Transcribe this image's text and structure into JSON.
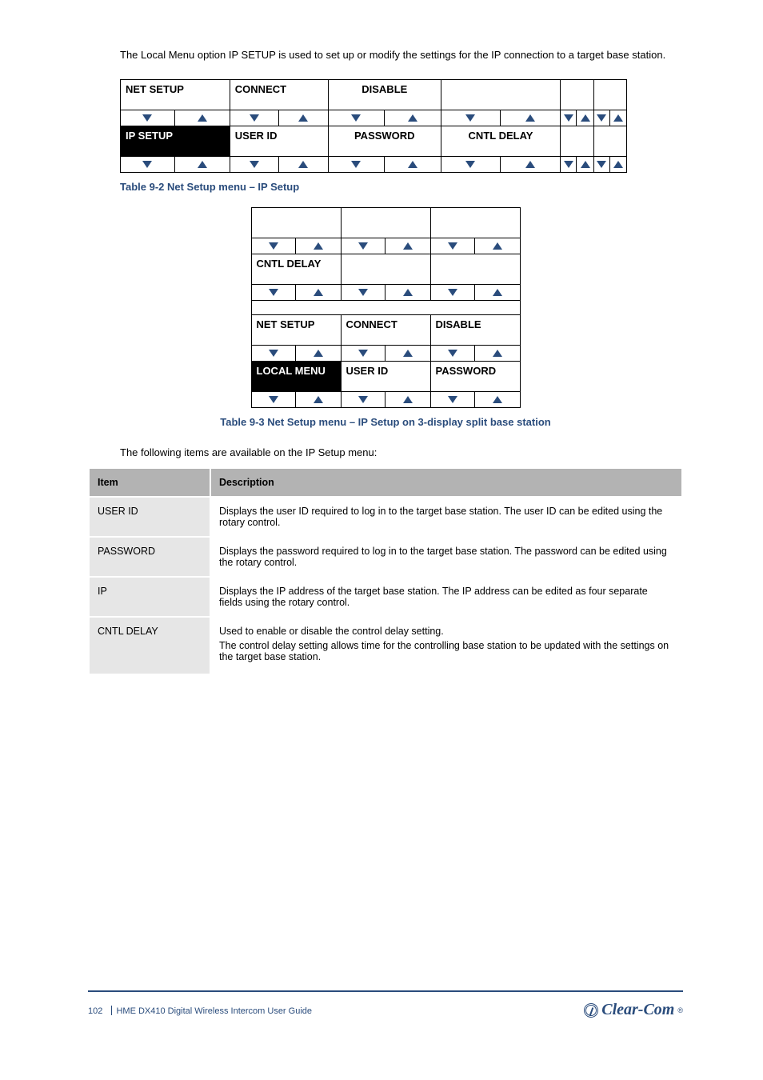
{
  "intro": "The Local Menu option IP SETUP is used to set up or modify the settings for the IP connection to a target base station.",
  "table6": {
    "rows": [
      {
        "cells": [
          "NET SETUP",
          "CONNECT",
          "DISABLE",
          "",
          "",
          ""
        ],
        "inv": []
      },
      {
        "cells": [
          "IP SETUP",
          "USER ID",
          "PASSWORD",
          "CNTL DELAY",
          "",
          ""
        ],
        "inv": [
          0
        ]
      }
    ]
  },
  "caption6": "Table 9-2 Net Setup menu – IP Setup",
  "table3": {
    "rows": [
      {
        "cells": [
          "",
          "",
          ""
        ],
        "inv": []
      },
      {
        "cells": [
          "CNTL DELAY",
          "",
          ""
        ],
        "inv": []
      },
      {
        "cells": [
          "NET SETUP",
          "CONNECT",
          "DISABLE"
        ],
        "inv": [],
        "gap_above": true
      },
      {
        "cells": [
          "LOCAL MENU",
          "USER ID",
          "PASSWORD"
        ],
        "inv": [
          0
        ]
      }
    ]
  },
  "caption3": "Table 9-3 Net Setup menu – IP Setup on 3-display split base station",
  "para": "The following items are available on the IP Setup menu:",
  "items_header": {
    "item": "Item",
    "desc": "Description"
  },
  "items": [
    {
      "item": "USER ID",
      "desc": "Displays the user ID required to log in to the target base station. The user ID can be edited using the rotary control."
    },
    {
      "item": "PASSWORD",
      "desc": "Displays the password required to log in to the target base station. The password can be edited using the rotary control."
    },
    {
      "item": "IP",
      "desc": "Displays the IP address of the target base station. The IP address can be edited as four separate fields using the rotary control."
    },
    {
      "item": "CNTL DELAY",
      "desc_lines": [
        "Used to enable or disable the control delay setting.",
        "The control delay setting allows time for the controlling base station to be updated with the settings on the target base station."
      ]
    }
  ],
  "footer": {
    "page": "102",
    "title": "HME DX410 Digital Wireless Intercom User Guide"
  },
  "logo": "Clear-Com"
}
